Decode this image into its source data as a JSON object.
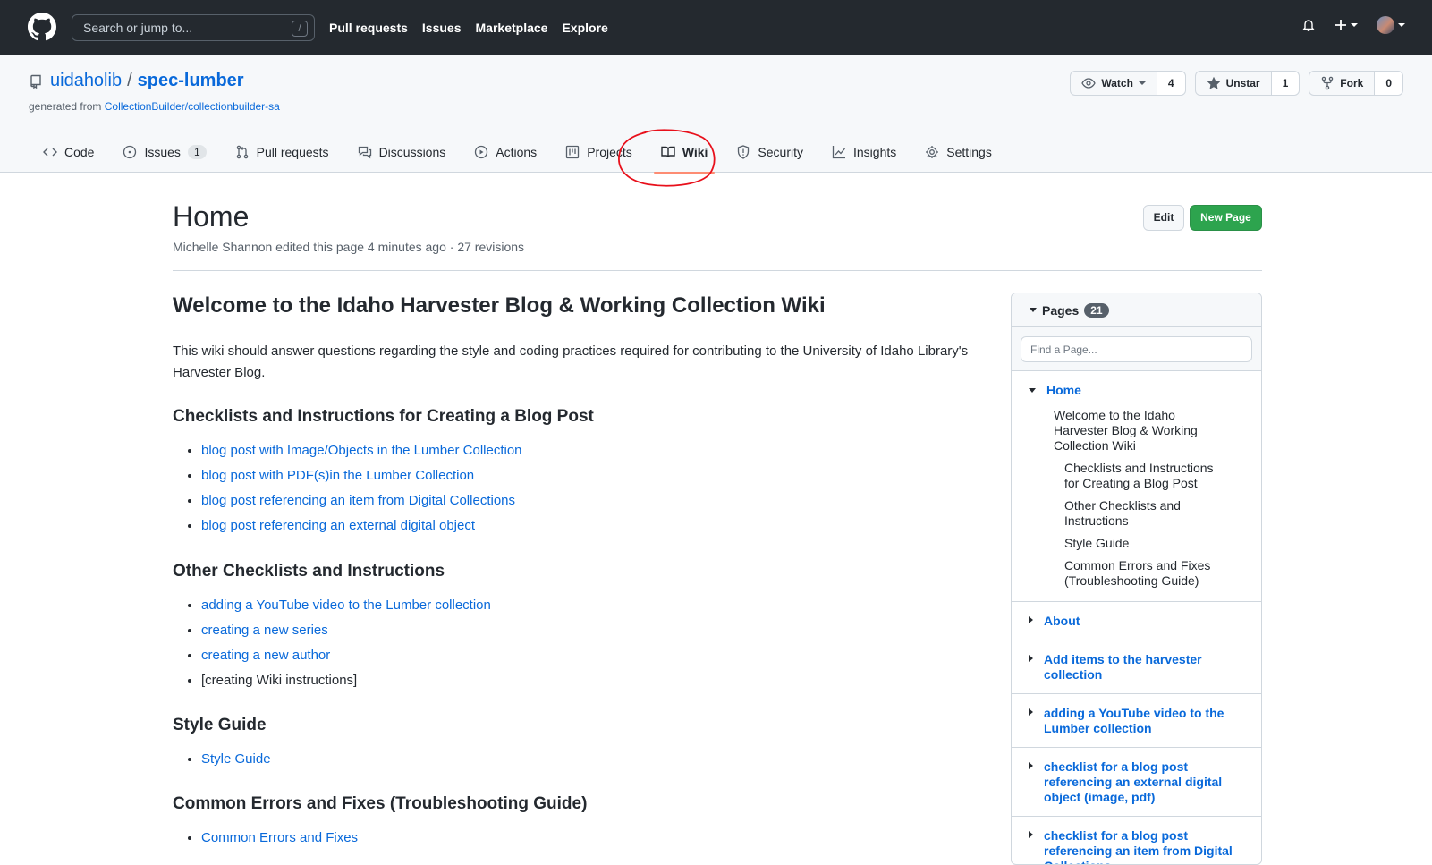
{
  "header": {
    "search_placeholder": "Search or jump to...",
    "search_key": "/",
    "nav": [
      "Pull requests",
      "Issues",
      "Marketplace",
      "Explore"
    ]
  },
  "repo": {
    "owner": "uidaholib",
    "separator": "/",
    "name": "spec-lumber",
    "generated_prefix": "generated from",
    "generated_link": "CollectionBuilder/collectionbuilder-sa",
    "watch_label": "Watch",
    "watch_count": "4",
    "star_label": "Unstar",
    "star_count": "1",
    "fork_label": "Fork",
    "fork_count": "0"
  },
  "tabs": [
    {
      "label": "Code",
      "icon": "code-icon"
    },
    {
      "label": "Issues",
      "icon": "issue-icon",
      "count": "1"
    },
    {
      "label": "Pull requests",
      "icon": "pull-request-icon"
    },
    {
      "label": "Discussions",
      "icon": "discussions-icon"
    },
    {
      "label": "Actions",
      "icon": "play-icon"
    },
    {
      "label": "Projects",
      "icon": "project-icon"
    },
    {
      "label": "Wiki",
      "icon": "book-icon",
      "selected": true
    },
    {
      "label": "Security",
      "icon": "shield-icon"
    },
    {
      "label": "Insights",
      "icon": "graph-icon"
    },
    {
      "label": "Settings",
      "icon": "gear-icon"
    }
  ],
  "page": {
    "title": "Home",
    "meta": "Michelle Shannon edited this page 4 minutes ago · 27 revisions",
    "edit_label": "Edit",
    "new_page_label": "New Page"
  },
  "content": {
    "h1": "Welcome to the Idaho Harvester Blog & Working Collection Wiki",
    "intro": "This wiki should answer questions regarding the style and coding practices required for contributing to the University of Idaho Library's Harvester Blog.",
    "sections": [
      {
        "heading": "Checklists and Instructions for Creating a Blog Post",
        "items": [
          "blog post with Image/Objects in the Lumber Collection",
          "blog post with PDF(s)in the Lumber Collection",
          "blog post referencing an item from Digital Collections",
          "blog post referencing an external digital object"
        ]
      },
      {
        "heading": "Other Checklists and Instructions",
        "items": [
          "adding a YouTube video to the Lumber collection",
          "creating a new series",
          "creating a new author",
          "[creating Wiki instructions]"
        ]
      },
      {
        "heading": "Style Guide",
        "items": [
          "Style Guide"
        ]
      },
      {
        "heading": "Common Errors and Fixes (Troubleshooting Guide)",
        "items": [
          "Common Errors and Fixes"
        ]
      }
    ]
  },
  "sidebar": {
    "title": "Pages",
    "count": "21",
    "find_placeholder": "Find a Page...",
    "home": {
      "label": "Home",
      "toc": [
        "Welcome to the Idaho Harvester Blog & Working Collection Wiki",
        "Checklists and Instructions for Creating a Blog Post",
        "Other Checklists and Instructions",
        "Style Guide",
        "Common Errors and Fixes (Troubleshooting Guide)"
      ]
    },
    "pages": [
      "About",
      "Add items to the harvester collection",
      "adding a YouTube video to the Lumber collection",
      "checklist for a blog post referencing an external digital object (image, pdf)",
      "checklist for a blog post referencing an item from Digital Collections"
    ]
  },
  "colors": {
    "header_bg": "#24292f",
    "link": "#0969da",
    "new_page_button": "#2da44e",
    "selected_tab_underline": "#fd8c73",
    "annotation_circle": "#e8101b"
  }
}
